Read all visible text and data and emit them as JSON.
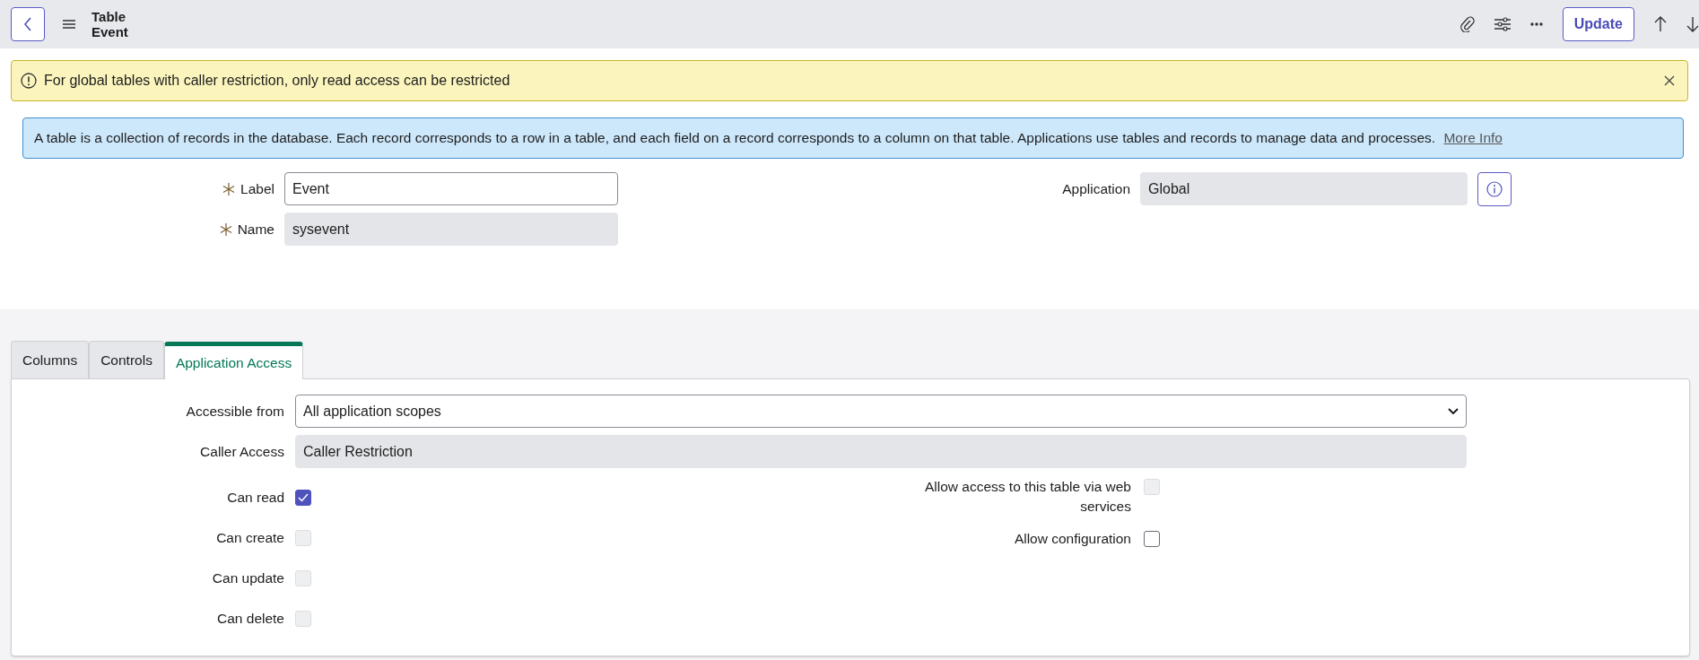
{
  "header": {
    "title": "Table",
    "subtitle": "Event",
    "update_button": "Update"
  },
  "warning": {
    "text": "For global tables with caller restriction, only read access can be restricted"
  },
  "info": {
    "text": "A table is a collection of records in the database. Each record corresponds to a row in a table, and each field on a record corresponds to a column on that table. Applications use tables and records to manage data and processes.",
    "link": "More Info"
  },
  "form": {
    "left": [
      {
        "label": "Label",
        "required": true,
        "readonly": false,
        "value": "Event"
      },
      {
        "label": "Name",
        "required": true,
        "readonly": true,
        "value": "sysevent"
      }
    ],
    "right": [
      {
        "label": "Application",
        "required": false,
        "readonly": true,
        "value": "Global"
      }
    ]
  },
  "tabs": [
    {
      "label": "Columns",
      "selected": false
    },
    {
      "label": "Controls",
      "selected": false
    },
    {
      "label": "Application Access",
      "selected": true
    }
  ],
  "access": {
    "fields": [
      {
        "kind": "select",
        "label": "Accessible from",
        "value": "All application scopes"
      },
      {
        "kind": "readonly",
        "label": "Caller Access",
        "value": "Caller Restriction"
      }
    ],
    "left_checks": [
      {
        "label": "Can read",
        "checked": true,
        "disabled": false
      },
      {
        "label": "Can create",
        "checked": false,
        "disabled": true
      },
      {
        "label": "Can update",
        "checked": false,
        "disabled": true
      },
      {
        "label": "Can delete",
        "checked": false,
        "disabled": true
      }
    ],
    "right_checks": [
      {
        "label": "Allow access to this table via web services",
        "checked": false,
        "disabled": true
      },
      {
        "label": "Allow configuration",
        "checked": false,
        "disabled": false
      }
    ]
  }
}
